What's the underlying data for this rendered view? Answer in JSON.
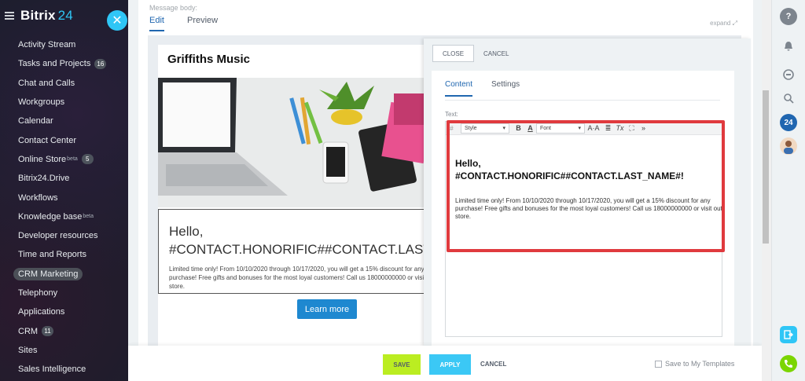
{
  "sidebar": {
    "logo_name": "Bitrix",
    "logo_num": "24",
    "close_icon": "✕",
    "items": [
      {
        "label": "Activity Stream",
        "badge": "",
        "sup": ""
      },
      {
        "label": "Tasks and Projects",
        "badge": "16",
        "sup": ""
      },
      {
        "label": "Chat and Calls",
        "badge": "",
        "sup": ""
      },
      {
        "label": "Workgroups",
        "badge": "",
        "sup": ""
      },
      {
        "label": "Calendar",
        "badge": "",
        "sup": ""
      },
      {
        "label": "Contact Center",
        "badge": "",
        "sup": ""
      },
      {
        "label": "Online Store",
        "badge": "5",
        "sup": "beta"
      },
      {
        "label": "Bitrix24.Drive",
        "badge": "",
        "sup": ""
      },
      {
        "label": "Workflows",
        "badge": "",
        "sup": ""
      },
      {
        "label": "Knowledge base",
        "badge": "",
        "sup": "beta"
      },
      {
        "label": "Developer resources",
        "badge": "",
        "sup": ""
      },
      {
        "label": "Time and Reports",
        "badge": "",
        "sup": ""
      },
      {
        "label": "CRM Marketing",
        "badge": "",
        "sup": ""
      },
      {
        "label": "Telephony",
        "badge": "",
        "sup": ""
      },
      {
        "label": "Applications",
        "badge": "",
        "sup": ""
      },
      {
        "label": "CRM",
        "badge": "11",
        "sup": ""
      },
      {
        "label": "Sites",
        "badge": "",
        "sup": ""
      },
      {
        "label": "Sales Intelligence",
        "badge": "",
        "sup": ""
      }
    ],
    "active_index": 12
  },
  "main": {
    "message_body_label": "Message body:",
    "tab_edit": "Edit",
    "tab_preview": "Preview",
    "expand_label": "expand ⤢"
  },
  "email": {
    "brand": "Griffiths Music",
    "hello": "Hello,",
    "tag_line": "#CONTACT.HONORIFIC##CONTACT.LAST_NAME#!",
    "body": "Limited time only! From 10/10/2020 through 10/17/2020, you will get a 15% discount for any purchase! Free gifts and bonuses for the most loyal customers! Call us 18000000000 or visit out store.",
    "cta": "Learn more"
  },
  "panel": {
    "close_label": "CLOSE",
    "cancel_label": "CANCEL",
    "tab_content": "Content",
    "tab_settings": "Settings",
    "text_label": "Text:",
    "toolbar": {
      "hash": "#",
      "style_select": "Style",
      "bold": "B",
      "fontcolor": "A",
      "font_select": "Font",
      "fontsize": "A·A",
      "align": "≣",
      "clear": "Tx",
      "fullscreen": "⛶",
      "more": "»"
    },
    "editor": {
      "hello": "Hello,",
      "tag_line": "#CONTACT.HONORIFIC##CONTACT.LAST_NAME#!",
      "body": "Limited time only! From 10/10/2020 through 10/17/2020, you will get a 15% discount for any purchase! Free gifts and bonuses for the most loyal customers! Call us 18000000000 or visit out store."
    }
  },
  "footer": {
    "save": "SAVE",
    "apply": "APPLY",
    "cancel": "CANCEL",
    "save_template": "Save to My Templates"
  },
  "rightbar": {
    "help_icon": "?",
    "counter_label": "24"
  },
  "colors": {
    "accent_blue": "#2067b0",
    "save_green": "#bbed21",
    "apply_cyan": "#3bc8f5",
    "highlight_red": "#e03a3e"
  }
}
